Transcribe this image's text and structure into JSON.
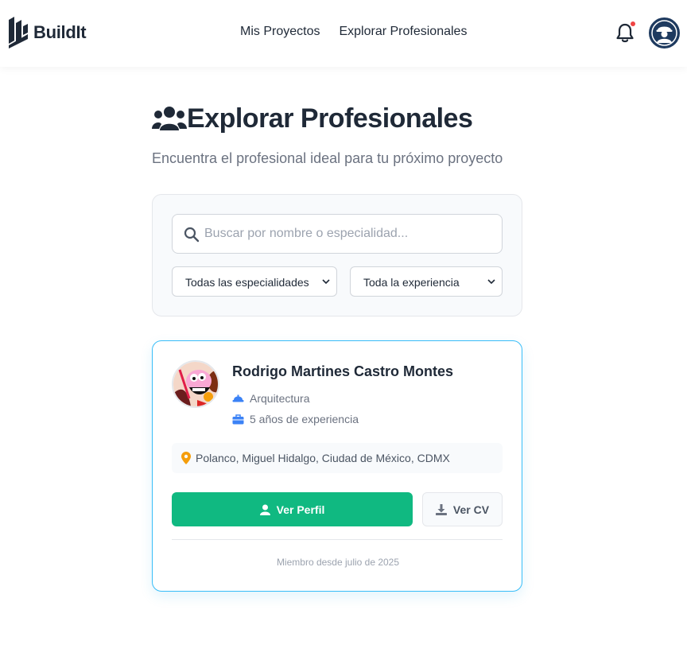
{
  "brand": {
    "name": "BuildIt"
  },
  "nav": {
    "items": [
      "Mis Proyectos",
      "Explorar Profesionales"
    ]
  },
  "page": {
    "title": "Explorar Profesionales",
    "subtitle": "Encuentra el profesional ideal para tu próximo proyecto"
  },
  "filters": {
    "search_placeholder": "Buscar por nombre o especialidad...",
    "specialty_selected": "Todas las especialidades",
    "experience_selected": "Toda la experiencia"
  },
  "professionals": [
    {
      "name": "Rodrigo Martines Castro Montes",
      "specialty": "Arquitectura",
      "experience": "5 años de experiencia",
      "location": "Polanco, Miguel Hidalgo, Ciudad de México, CDMX",
      "view_profile_label": "Ver Perfil",
      "view_cv_label": "Ver CV",
      "member_since": "Miembro desde julio de 2025"
    }
  ],
  "colors": {
    "primary": "#10b981",
    "accent_border": "#38bdf8",
    "icon_blue": "#3b82f6",
    "location_icon": "#f59e0b",
    "notification_dot": "#ef4444",
    "dark": "#1f2937"
  },
  "icons": {
    "logo": "building-logo-icon",
    "notification": "bell-icon",
    "profile": "hardhat-avatar-icon",
    "title": "users-icon",
    "search": "search-icon",
    "specialty": "hardhat-icon",
    "experience": "briefcase-icon",
    "location": "map-pin-icon",
    "view_profile": "user-icon",
    "view_cv": "download-icon"
  }
}
